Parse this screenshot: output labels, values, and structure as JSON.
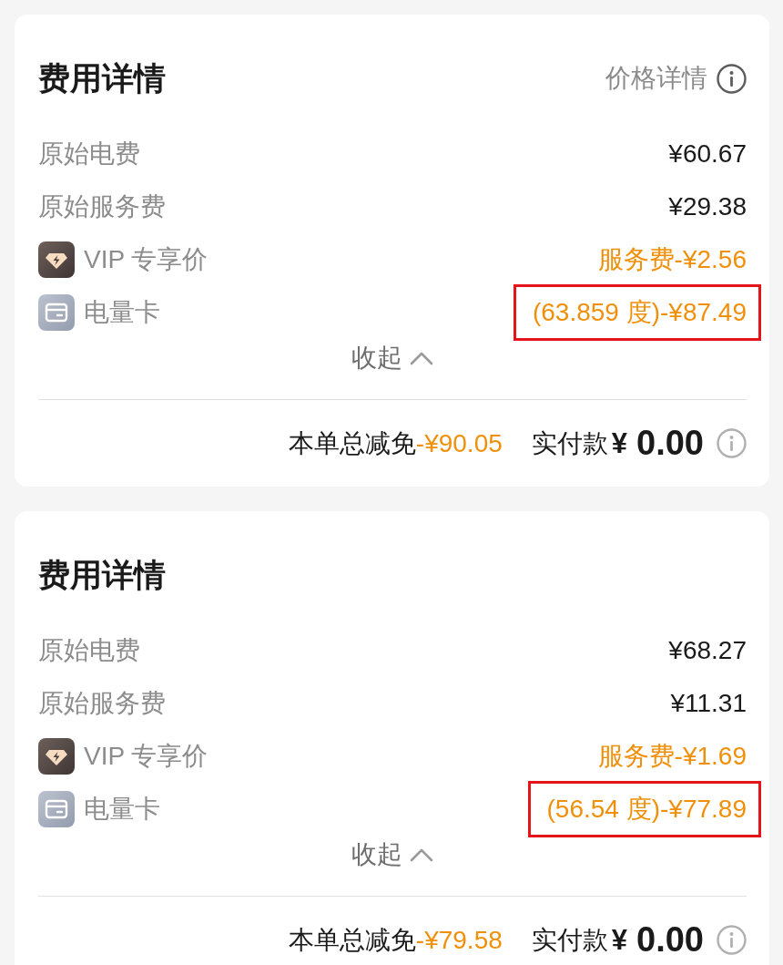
{
  "cards": [
    {
      "title": "费用详情",
      "price_link": {
        "label": "价格详情"
      },
      "items": [
        {
          "kind": "plain",
          "label": "原始电费",
          "value": "¥60.67",
          "highlighted": false
        },
        {
          "kind": "plain",
          "label": "原始服务费",
          "value": "¥29.38",
          "highlighted": false
        },
        {
          "kind": "vip",
          "label": "VIP 专享价",
          "value": "服务费-¥2.56",
          "highlighted": false
        },
        {
          "kind": "energy_card",
          "label": "电量卡",
          "value": "(63.859 度)-¥87.49",
          "highlighted": true
        }
      ],
      "collapse": {
        "label": "收起",
        "expanded": true
      },
      "summary": {
        "discount_label": "本单总减免",
        "discount_value": "-¥90.05",
        "paid_label": "实付款",
        "paid_currency": "¥",
        "paid_value": "0.00"
      }
    },
    {
      "title": "费用详情",
      "items": [
        {
          "kind": "plain",
          "label": "原始电费",
          "value": "¥68.27",
          "highlighted": false
        },
        {
          "kind": "plain",
          "label": "原始服务费",
          "value": "¥11.31",
          "highlighted": false
        },
        {
          "kind": "vip",
          "label": "VIP 专享价",
          "value": "服务费-¥1.69",
          "highlighted": false
        },
        {
          "kind": "energy_card",
          "label": "电量卡",
          "value": "(56.54 度)-¥77.89",
          "highlighted": true
        }
      ],
      "collapse": {
        "label": "收起",
        "expanded": true
      },
      "summary": {
        "discount_label": "本单总减免",
        "discount_value": "-¥79.58",
        "paid_label": "实付款",
        "paid_currency": "¥",
        "paid_value": "0.00"
      }
    }
  ]
}
